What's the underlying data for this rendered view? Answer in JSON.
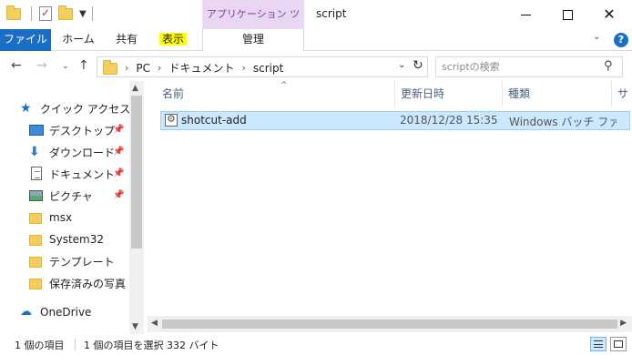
{
  "window": {
    "title": "script",
    "contextual_tab_group": "アプリケーション ツール"
  },
  "ribbon": {
    "tabs": [
      "ファイル",
      "ホーム",
      "共有",
      "表示",
      "管理"
    ],
    "highlighted_tab": "表示"
  },
  "address": {
    "crumbs": [
      "PC",
      "ドキュメント",
      "script"
    ]
  },
  "search": {
    "placeholder": "scriptの検索"
  },
  "navpane": {
    "quick_access": "クイック アクセス",
    "pinned": [
      {
        "label": "デスクトップ",
        "icon": "desktop-icon"
      },
      {
        "label": "ダウンロード",
        "icon": "download-icon"
      },
      {
        "label": "ドキュメント",
        "icon": "document-icon"
      },
      {
        "label": "ピクチャ",
        "icon": "picture-icon"
      }
    ],
    "folders": [
      "msx",
      "System32",
      "テンプレート",
      "保存済みの写真"
    ],
    "onedrive": "OneDrive"
  },
  "columns": [
    "名前",
    "更新日時",
    "種類",
    "サイ"
  ],
  "files": [
    {
      "name": "shotcut-add",
      "modified": "2018/12/28 15:35",
      "type": "Windows バッチ ファ...",
      "icon": "batch-file-icon",
      "selected": true
    }
  ],
  "status": {
    "item_count": "1 個の項目",
    "selection": "1 個の項目を選択  332 バイト"
  }
}
